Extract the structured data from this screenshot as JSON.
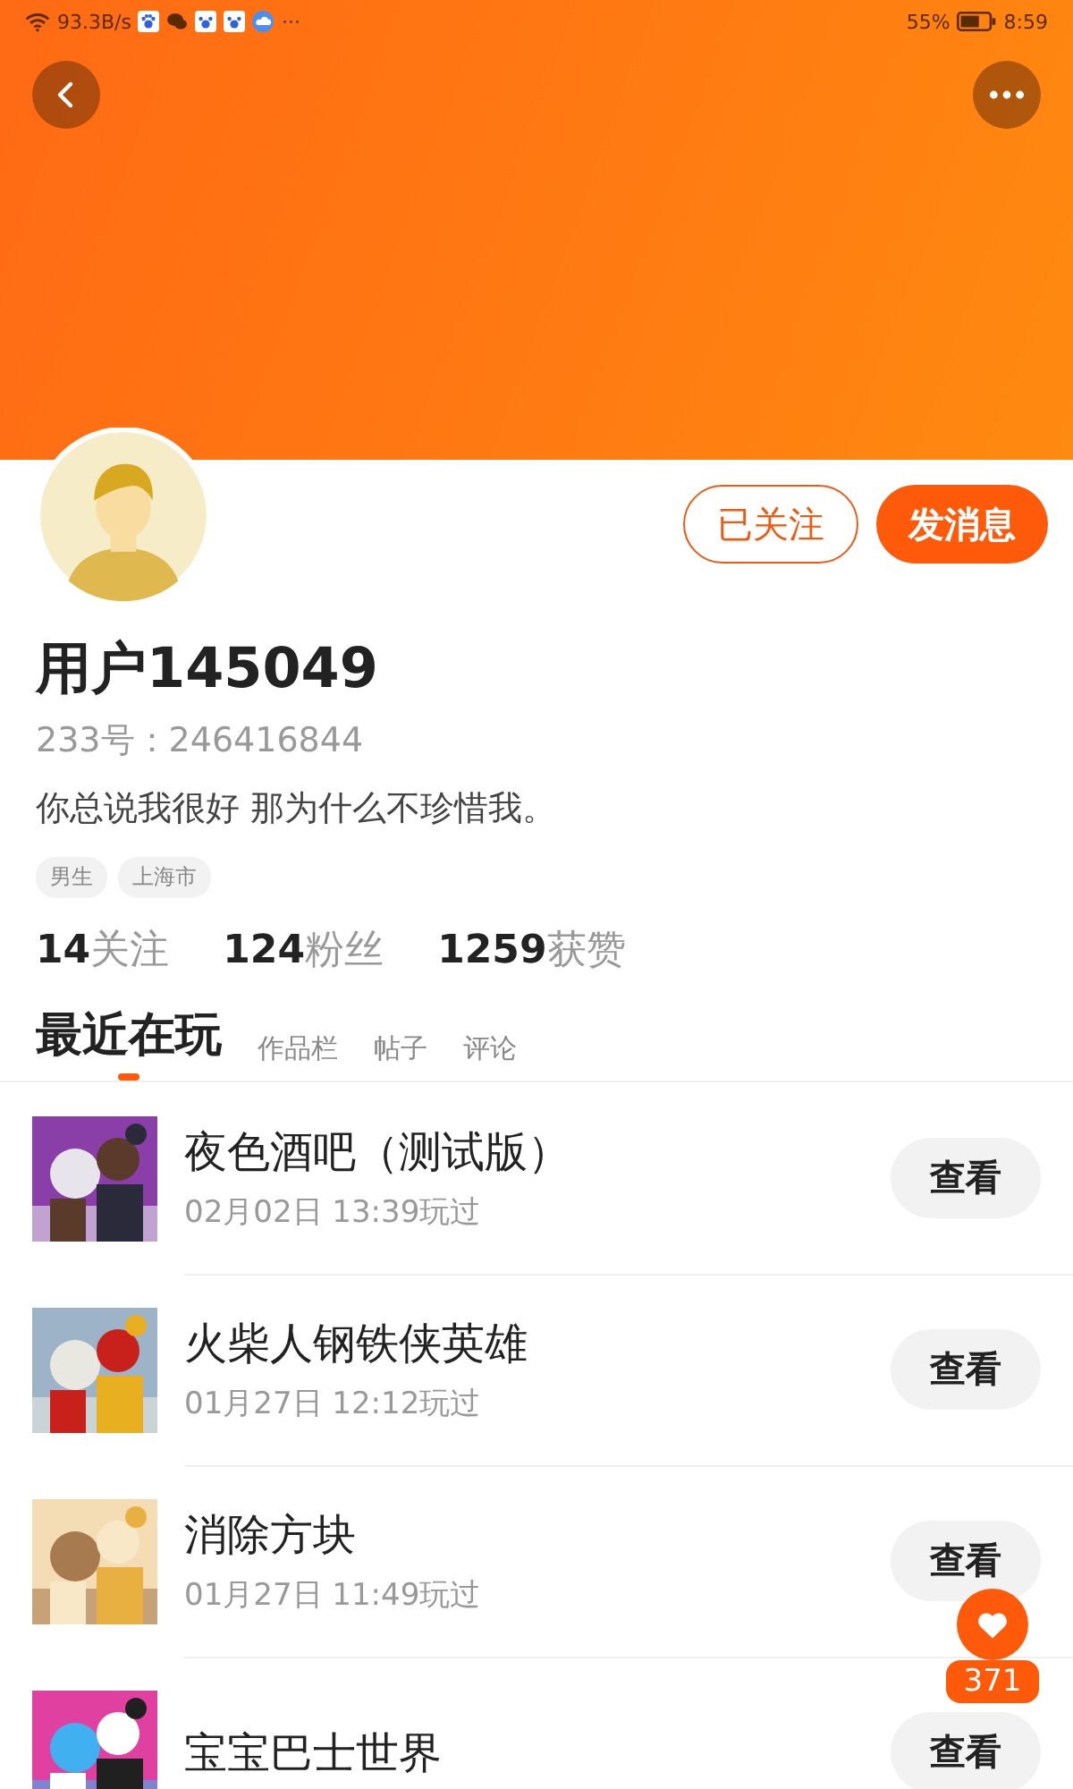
{
  "status_bar": {
    "speed": "93.3B/s",
    "more": "···",
    "battery": "55%",
    "time": "8:59"
  },
  "profile": {
    "name": "用户145049",
    "id_line": "233号：246416844",
    "bio": "你总说我很好 那为什么不珍惜我。",
    "tags": [
      "男生",
      "上海市"
    ],
    "follow_button": {
      "label": "已关注",
      "followed": true
    },
    "message_button": "发消息"
  },
  "stats": [
    "**14**关注",
    "**124**粉丝",
    "**1259**获赞"
  ],
  "tabs": [
    {
      "label": "最近在玩",
      "selected": true
    },
    {
      "label": "作品栏",
      "selected": false
    },
    {
      "label": "帖子",
      "selected": false
    },
    {
      "label": "评论",
      "selected": false
    }
  ],
  "games": [
    {
      "title": "夜色酒吧（测试版）",
      "played": "02月02日 13:39玩过",
      "button": "查看"
    },
    {
      "title": "火柴人钢铁侠英雄",
      "played": "01月27日 12:12玩过",
      "button": "查看"
    },
    {
      "title": "消除方块",
      "played": "01月27日 11:49玩过",
      "button": "查看"
    },
    {
      "title": "宝宝巴士世界",
      "button": "查看"
    }
  ],
  "like_badge": {
    "count": "371"
  }
}
